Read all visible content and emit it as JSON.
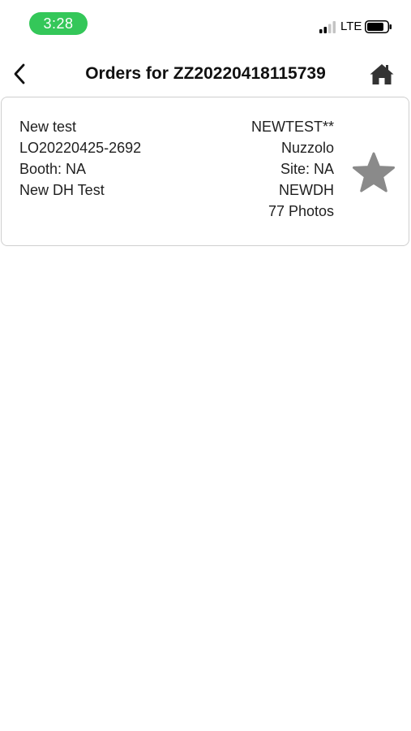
{
  "status_bar": {
    "time": "3:28",
    "network": "LTE",
    "icons": {
      "signal": "signal-bars-icon",
      "battery": "battery-icon"
    },
    "pill_color": "#34c759"
  },
  "header": {
    "title": "Orders for ZZ20220418115739",
    "back_icon": "chevron-left-icon",
    "home_icon": "home-icon"
  },
  "orders": [
    {
      "name": "New test",
      "order_id": "LO20220425-2692",
      "booth": "Booth: NA",
      "description": "New DH Test",
      "code": "NEWTEST**",
      "customer": "Nuzzolo",
      "site": "Site: NA",
      "group": "NEWDH",
      "photos": "77 Photos",
      "favorite_icon": "star-icon",
      "favorite_color": "#8a8a8a"
    }
  ]
}
